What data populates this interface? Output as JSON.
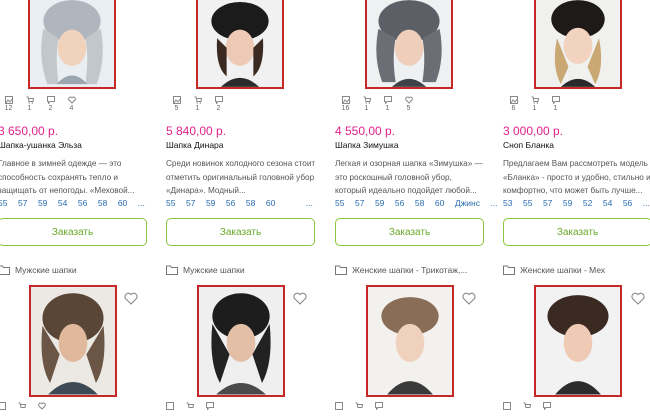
{
  "products": [
    {
      "title": "Шапка-ушанка Эльза",
      "price": "3 650,00 р.",
      "stats": [
        "12",
        "1",
        "2",
        "4"
      ],
      "desc": "Главное в зимней одежде — это способность сохранять тепло и защищать от непогоды. «Меховой...",
      "sizes": [
        "55",
        "57",
        "59",
        "54",
        "56",
        "58",
        "60",
        "..."
      ],
      "order_label": "Заказать",
      "category": "Мужские шапки"
    },
    {
      "title": "Шапка Динара",
      "price": "5 840,00 р.",
      "stats": [
        "5",
        "1",
        "2",
        ""
      ],
      "desc": "Среди новинок холодного сезона стоит отметить оригинальный головной убор «Динара». Модный...",
      "sizes": [
        "55",
        "57",
        "59",
        "56",
        "58",
        "60",
        "..."
      ],
      "order_label": "Заказать",
      "category": "Мужские шапки"
    },
    {
      "title": "Шапка Зимушка",
      "price": "4 550,00 р.",
      "stats": [
        "16",
        "1",
        "1",
        "5"
      ],
      "desc": "Легкая и озорная шапка «Зимушка» — это роскошный головной убор, который идеально подойдет любой...",
      "sizes": [
        "55",
        "57",
        "59",
        "56",
        "58",
        "60",
        "Джинс",
        "..."
      ],
      "order_label": "Заказать",
      "category": "Женские шапки - Трикотаж,..."
    },
    {
      "title": "Сноп Бланка",
      "price": "3 000,00 р.",
      "stats": [
        "6",
        "1",
        "1",
        ""
      ],
      "desc": "Предлагаем Вам рассмотреть модель «Бланка» - просто и удобно, стильно и комфортно, что может быть лучше...",
      "sizes": [
        "53",
        "55",
        "57",
        "59",
        "52",
        "54",
        "56",
        "..."
      ],
      "order_label": "Заказать",
      "category": "Женские шапки - Мех"
    }
  ],
  "icons": {
    "photo": "photo-icon",
    "cart": "cart-icon",
    "comment": "comment-icon",
    "like": "heart-icon",
    "folder": "folder-icon"
  },
  "colors": {
    "price": "#e0218a",
    "button_border": "#8cc63f",
    "photo_border": "#c62828",
    "size_link": "#2a6db0"
  }
}
